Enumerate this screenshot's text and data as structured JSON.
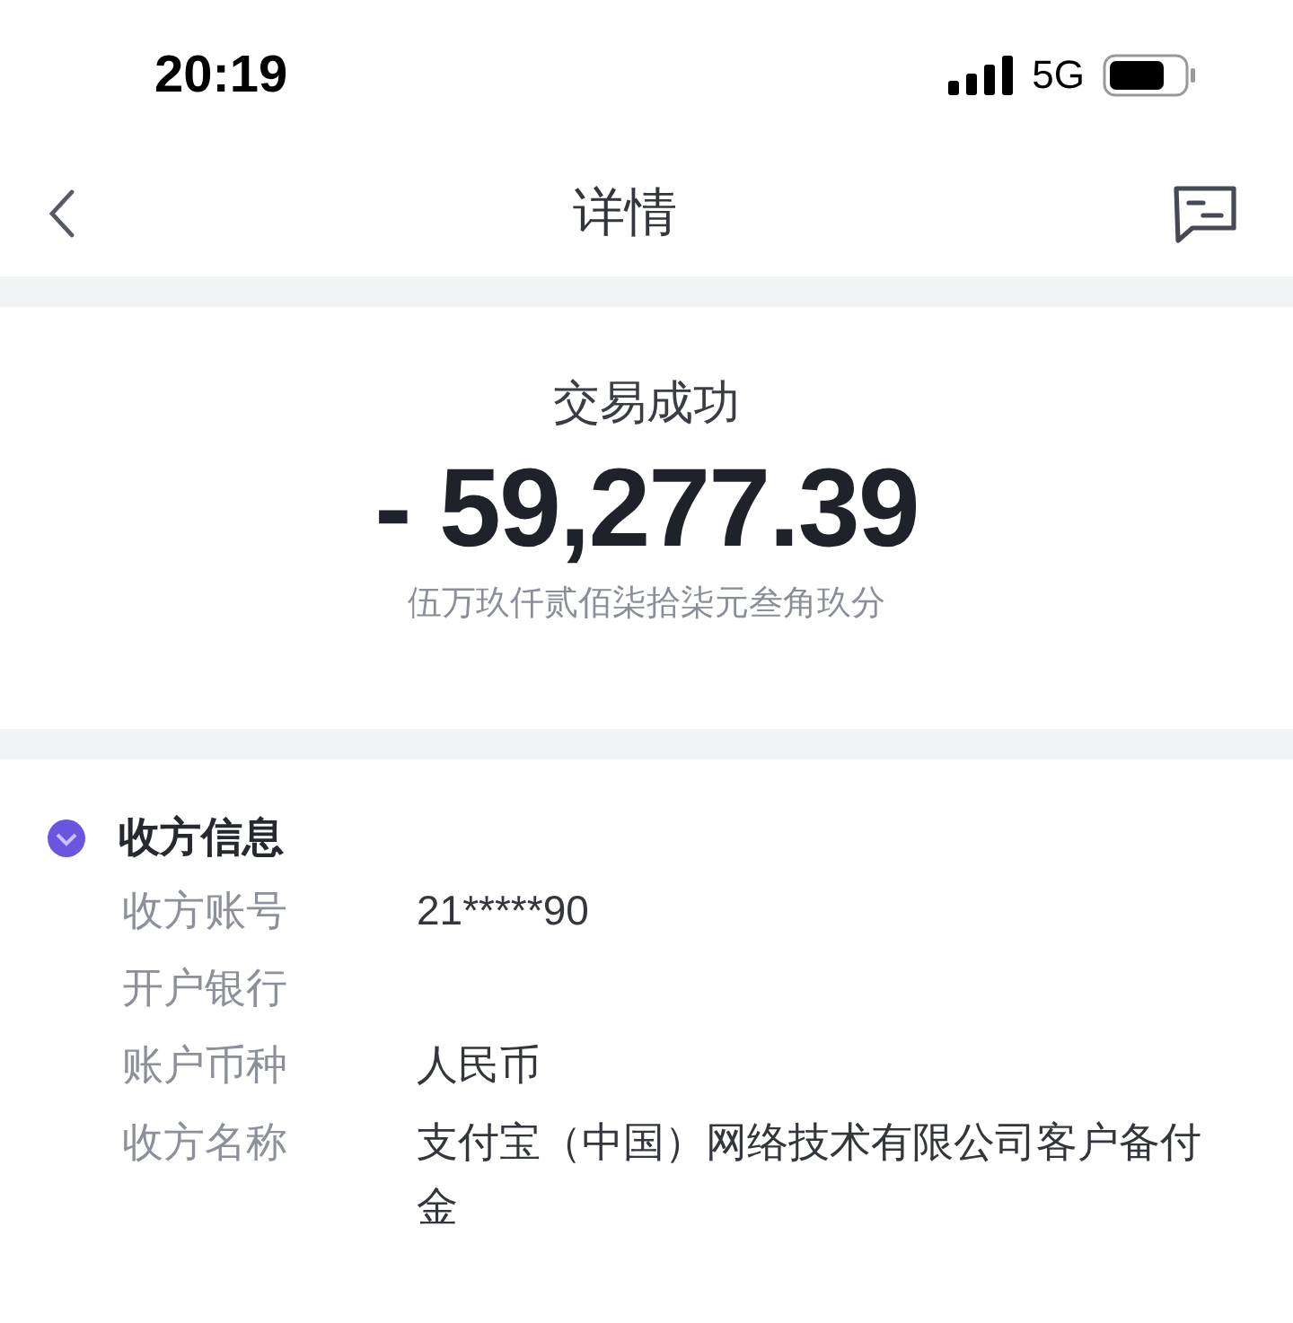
{
  "status_bar": {
    "time": "20:19",
    "network": "5G"
  },
  "nav": {
    "title": "详情"
  },
  "summary": {
    "status": "交易成功",
    "amount": "- 59,277.39",
    "amount_words": "伍万玖仟贰佰柒拾柒元叁角玖分"
  },
  "payee": {
    "title": "收方信息",
    "rows": [
      {
        "label": "收方账号",
        "value": "21*****90"
      },
      {
        "label": "开户银行"
      },
      {
        "label": "账户币种",
        "value": "人民币"
      },
      {
        "label": "收方名称",
        "value": "支付宝（中国）网络技术有限公司客户备付金"
      }
    ]
  }
}
